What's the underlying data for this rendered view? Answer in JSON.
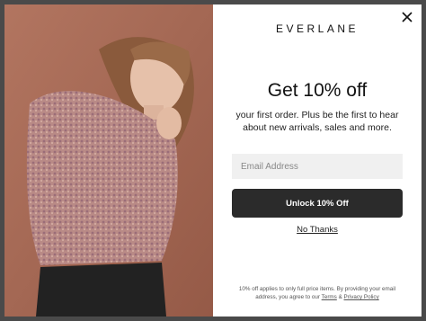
{
  "brand": "EVERLANE",
  "headline": "Get 10% off",
  "subtitle": "your first order. Plus be the first to hear about new arrivals, sales and more.",
  "email_placeholder": "Email Address",
  "unlock_label": "Unlock 10% Off",
  "no_thanks_label": "No Thanks",
  "fine_print": {
    "before": "10% off applies to only full price items. By providing your email address, you agree to our",
    "terms": "Terms",
    "and": "&",
    "privacy": "Privacy Policy"
  },
  "icons": {
    "close": "close-icon"
  },
  "colors": {
    "button": "#2b2b2b",
    "photo_bg": "#a86a55",
    "input_bg": "#f0f0f0"
  }
}
